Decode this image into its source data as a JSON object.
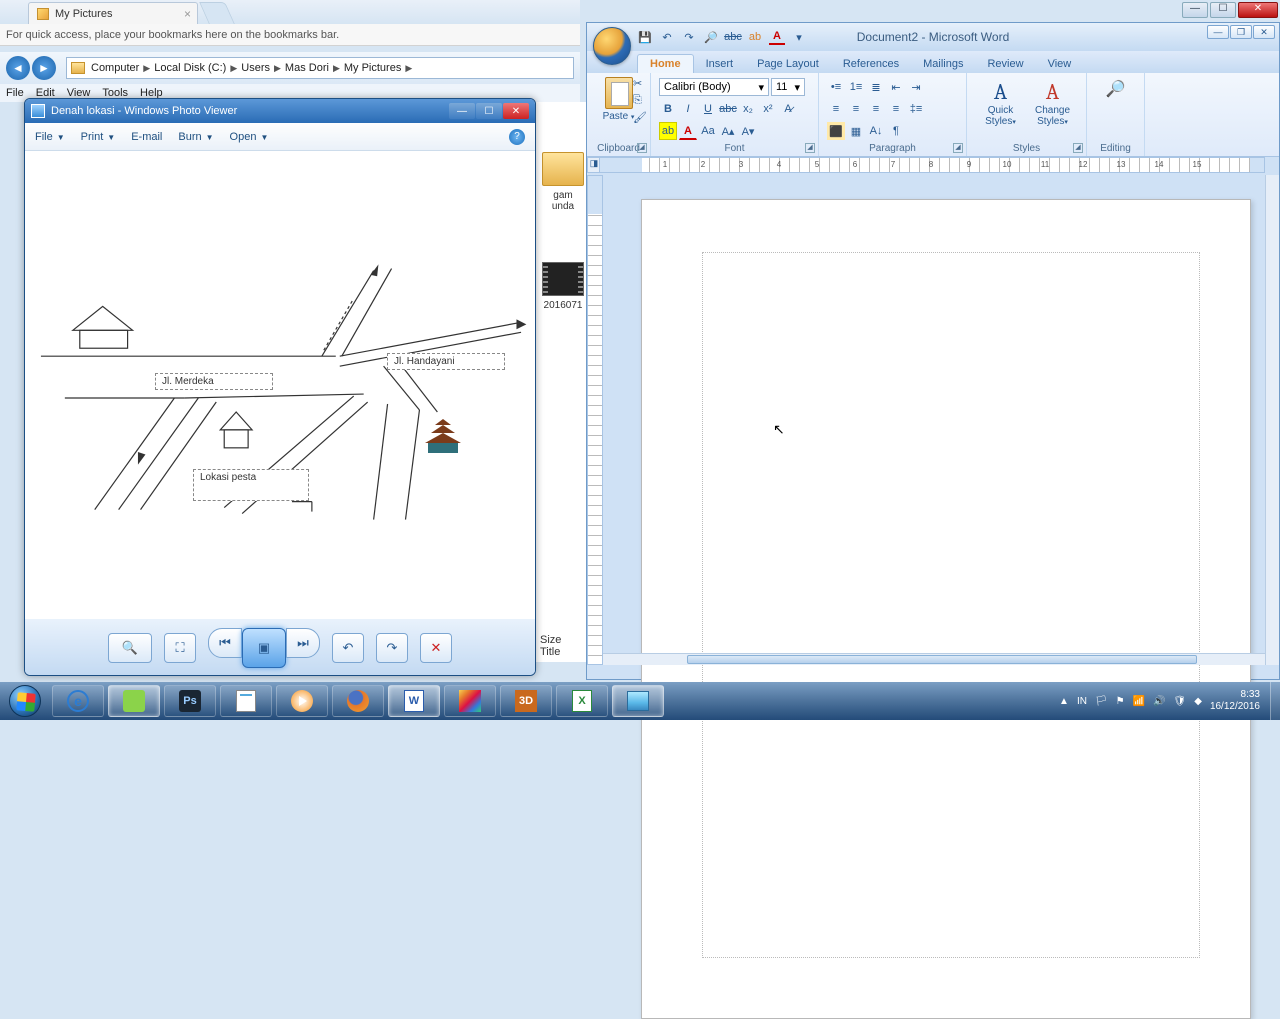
{
  "browser": {
    "tab_title": "My Pictures",
    "bookmarks_hint": "For quick access, place your bookmarks here on the bookmarks bar."
  },
  "explorer": {
    "menu": [
      "File",
      "Edit",
      "View",
      "Tools",
      "Help"
    ],
    "path": [
      "Computer",
      "Local Disk (C:)",
      "Users",
      "Mas Dori",
      "My Pictures"
    ],
    "items": [
      {
        "name_line1": "gam",
        "name_line2": "unda"
      },
      {
        "name_line1": "2016071"
      }
    ],
    "details": {
      "size_label": "Size",
      "title_label": "Title"
    }
  },
  "photo_viewer": {
    "title": "Denah lokasi - Windows Photo Viewer",
    "menu": {
      "file": "File",
      "print": "Print",
      "email": "E-mail",
      "burn": "Burn",
      "open": "Open"
    },
    "labels": {
      "merdeka": "Jl. Merdeka",
      "handayani": "Jl. Handayani",
      "lokasi": "Lokasi pesta"
    }
  },
  "word": {
    "title": "Document2 - Microsoft Word",
    "tabs": [
      "Home",
      "Insert",
      "Page Layout",
      "References",
      "Mailings",
      "Review",
      "View"
    ],
    "font": {
      "name": "Calibri (Body)",
      "size": "11"
    },
    "groups": {
      "clipboard": "Clipboard",
      "font": "Font",
      "paragraph": "Paragraph",
      "styles": "Styles",
      "editing": "Editing"
    },
    "clipboard": {
      "paste": "Paste"
    },
    "styles": {
      "quick": "Quick Styles",
      "change": "Change Styles"
    },
    "ruler_nums": [
      "1",
      "2",
      "3",
      "4",
      "5",
      "6",
      "7",
      "8",
      "9",
      "10",
      "11",
      "12",
      "13",
      "14",
      "15"
    ]
  },
  "tray": {
    "lang": "IN",
    "time": "8:33",
    "date": "16/12/2016"
  }
}
